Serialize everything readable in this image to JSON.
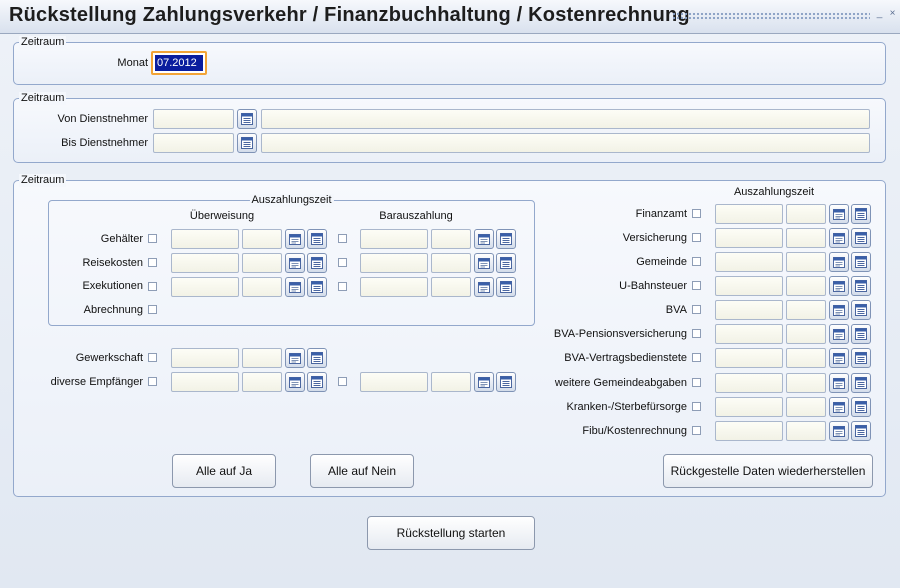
{
  "window": {
    "title": "Rückstellung Zahlungsverkehr / Finanzbuchhaltung / Kostenrechnung",
    "minimize_glyph": "_",
    "close_glyph": "×"
  },
  "group1": {
    "legend": "Zeitraum",
    "monat_label": "Monat",
    "monat_value": "07.2012"
  },
  "group2": {
    "legend": "Zeitraum",
    "von_label": "Von Dienstnehmer",
    "bis_label": "Bis Dienstnehmer"
  },
  "group3": {
    "legend": "Zeitraum",
    "inner_legend": "Auszahlungszeit",
    "col_ueberweisung": "Überweisung",
    "col_barauszahlung": "Barauszahlung",
    "right_header": "Auszahlungszeit",
    "left_rows": {
      "gehaelter": "Gehälter",
      "reisekosten": "Reisekosten",
      "exekutionen": "Exekutionen",
      "abrechnung": "Abrechnung",
      "gewerkschaft": "Gewerkschaft",
      "diverse": "diverse Empfänger"
    },
    "right_rows": {
      "finanzamt": "Finanzamt",
      "versicherung": "Versicherung",
      "gemeinde": "Gemeinde",
      "ubahnsteuer": "U-Bahnsteuer",
      "bva": "BVA",
      "bva_pension": "BVA-Pensionsversicherung",
      "bva_vertrag": "BVA-Vertragsbedienstete",
      "weitere": "weitere Gemeindeabgaben",
      "kranken": "Kranken-/Sterbefürsorge",
      "fibu": "Fibu/Kostenrechnung"
    },
    "btn_alle_ja": "Alle auf Ja",
    "btn_alle_nein": "Alle auf Nein",
    "btn_wiederherstellen": "Rückgestelle Daten wiederherstellen"
  },
  "footer": {
    "btn_start": "Rückstellung starten"
  }
}
